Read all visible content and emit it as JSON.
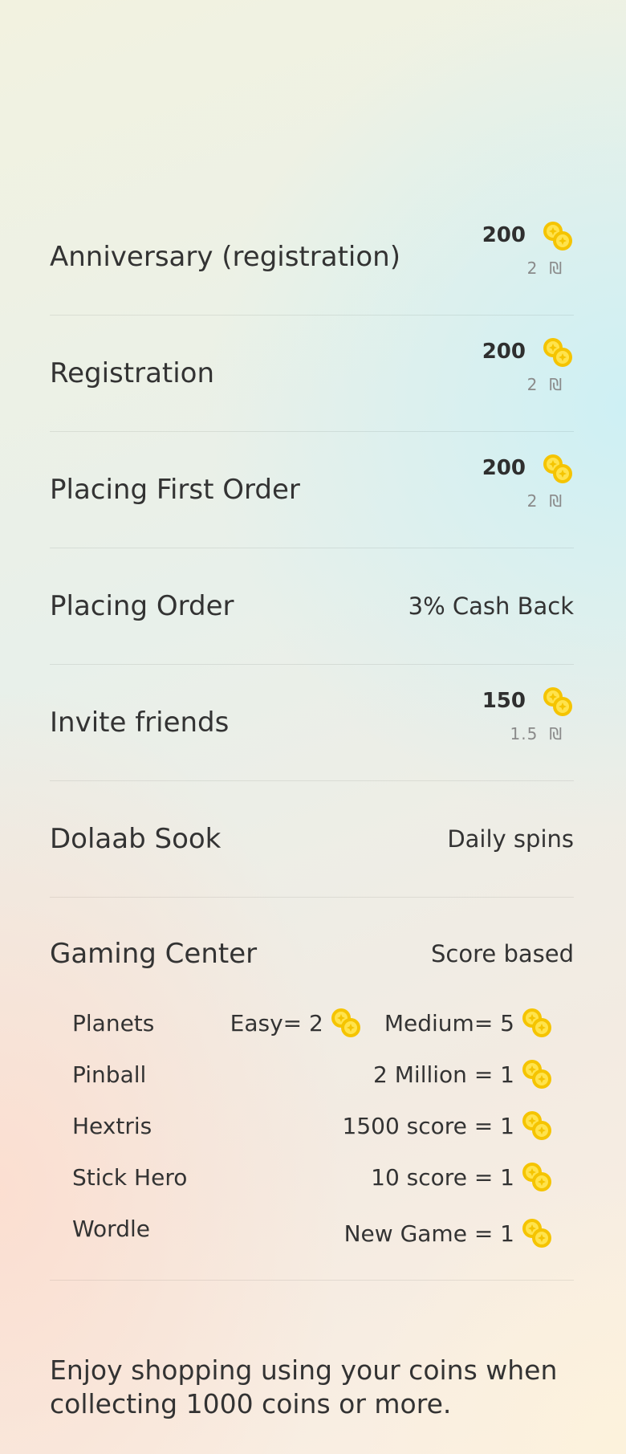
{
  "rows": [
    {
      "label": "Anniversary (registration)",
      "coins": "200",
      "value": "2",
      "currency": "₪"
    },
    {
      "label": "Registration",
      "coins": "200",
      "value": "2",
      "currency": "₪"
    },
    {
      "label": "Placing First Order",
      "coins": "200",
      "value": "2",
      "currency": "₪"
    },
    {
      "label": "Placing Order",
      "right_text": "3% Cash Back"
    },
    {
      "label": "Invite friends",
      "coins": "150",
      "value": "1.5",
      "currency": "₪"
    },
    {
      "label": "Dolaab Sook",
      "right_text": "Daily spins"
    }
  ],
  "gaming_center": {
    "label": "Gaming Center",
    "right_text": "Score based",
    "games": [
      {
        "name": "Planets",
        "rule_a": "Easy= 2",
        "rule_b": "Medium= 5"
      },
      {
        "name": "Pinball",
        "rule": "2 Million = 1"
      },
      {
        "name": "Hextris",
        "rule": "1500 score = 1"
      },
      {
        "name": "Stick Hero",
        "rule": "10 score = 1"
      },
      {
        "name": "Wordle",
        "rule": "New Game = 1"
      }
    ]
  },
  "footer": {
    "text": "Enjoy shopping using your coins when collecting 1000 coins or more."
  },
  "colors": {
    "coin_gold": "#f5c400",
    "coin_light": "#ffe34d"
  },
  "icons": {
    "coin": "coins-icon"
  }
}
